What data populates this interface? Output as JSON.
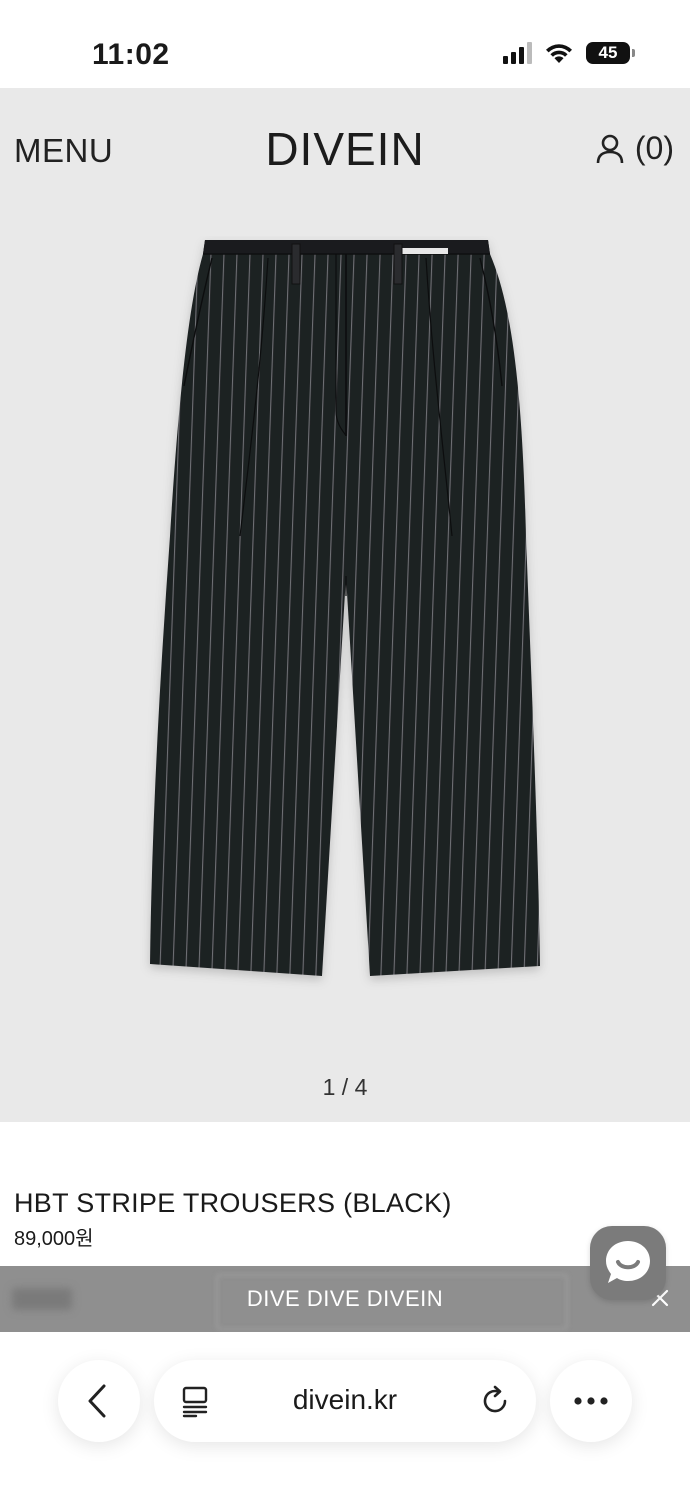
{
  "status_bar": {
    "time": "11:02",
    "battery_level": "45"
  },
  "header": {
    "menu_label": "MENU",
    "brand": "DIVEIN",
    "cart_count": "(0)"
  },
  "gallery": {
    "image_icon": "striped-trousers-image",
    "counter": "1 / 4"
  },
  "product": {
    "title": "HBT STRIPE TROUSERS (BLACK)",
    "price": "89,000원"
  },
  "banner": {
    "text": "DIVE DIVE DIVEIN"
  },
  "browser": {
    "url": "divein.kr"
  },
  "icons": {
    "account": "person-icon",
    "chat": "chat-bubble-icon",
    "back": "chevron-left-icon",
    "reader": "reader-mode-icon",
    "reload": "reload-icon",
    "more": "more-dots-icon",
    "close": "close-icon"
  },
  "colors": {
    "hero_background": "#e9e9e9",
    "banner_background": "#8f8f8f",
    "chat_button": "#7b7b7b"
  }
}
